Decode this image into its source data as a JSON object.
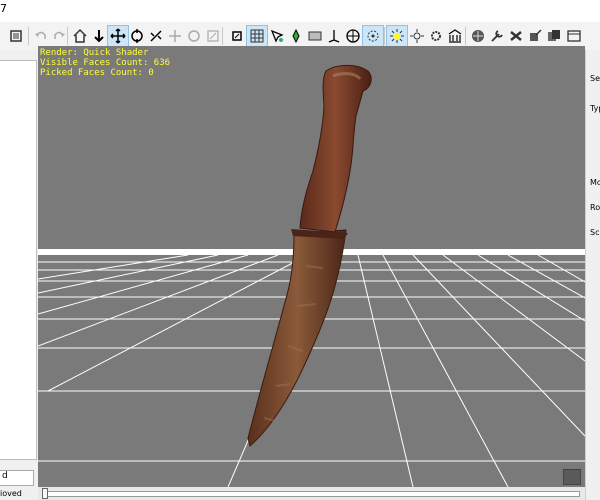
{
  "window": {
    "title_fragment": "7"
  },
  "overlay": {
    "render": "Render: Quick Shader",
    "visible_faces": "Visible Faces Count: 636",
    "picked_faces": "Picked Faces Count: 0"
  },
  "left_panel": {
    "bottom_field": "d",
    "bottom_text": "ioved"
  },
  "right_panel": {
    "label_sel": "Se",
    "label_typ": "Typ",
    "label_mov": "Mov",
    "label_ro": "Ro",
    "label_sc": "Sc"
  },
  "toolbar": {
    "tools": [
      "settings-icon",
      "undo-icon",
      "redo-icon",
      "home-icon",
      "down-arrow-icon",
      "move-icon",
      "rotate-icon",
      "link-icon",
      "pan-icon",
      "reset-icon",
      "resize-icon",
      "box-select-icon",
      "grid-icon",
      "pick-icon",
      "paint-icon",
      "plane-icon",
      "axis-icon",
      "globe-icon",
      "target-icon",
      "light-icon",
      "sun-icon",
      "gear-light-icon",
      "building-icon",
      "world-icon",
      "wrench-icon",
      "bones-icon",
      "export-icon",
      "copy-icon",
      "window-icon"
    ]
  },
  "colors": {
    "viewport_bg": "#7a7a7a",
    "overlay_text": "#ffff33",
    "grid": "#ffffff"
  }
}
